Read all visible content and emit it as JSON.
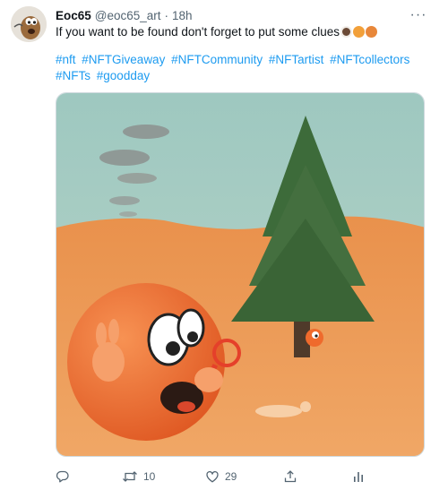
{
  "tweet": {
    "display_name": "Eoc65",
    "handle": "@eoc65_art",
    "separator": "·",
    "time": "18h",
    "text": "If you want to be found don't forget to put some clues",
    "emojis": [
      "coffee-emoji",
      "woman-emoji",
      "man-emoji"
    ],
    "hashtags": [
      "#nft",
      "#NFTGiveaway",
      "#NFTCommunity",
      "#NFTartist",
      "#NFTcollectors",
      "#NFTs",
      "#goodday"
    ],
    "more_label": "···"
  },
  "actions": {
    "reply_count": "",
    "retweet_count": "10",
    "like_count": "29"
  },
  "colors": {
    "link": "#1d9bf0",
    "secondary_text": "#536471",
    "sky": "#a9cfc9",
    "ground": "#ec9a55",
    "tree": "#3f6e3c",
    "character": "#ef6a2c"
  },
  "icons": {
    "reply": "comment-icon",
    "retweet": "retweet-icon",
    "like": "heart-icon",
    "share": "share-icon",
    "analytics": "analytics-icon",
    "more": "more-icon"
  }
}
